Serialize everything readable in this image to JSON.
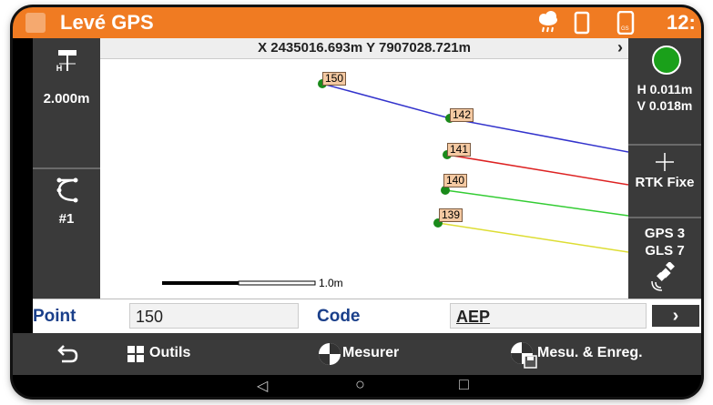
{
  "app": {
    "title": "Levé GPS",
    "clock": "12:"
  },
  "status": {
    "icons": [
      "cloud-rain-icon",
      "battery-icon",
      "gps-device-icon"
    ],
    "device_label": "GS"
  },
  "coords": {
    "text": "X 2435016.693m Y 7907028.721m",
    "chevron": "›"
  },
  "left_panel": {
    "antenna_label": "H",
    "antenna_height": "2.000m",
    "stakeout_label": "#1"
  },
  "right_panel": {
    "precision_h": "H 0.011m",
    "precision_v": "V 0.018m",
    "solution": "RTK Fixe",
    "gps_count": "GPS 3",
    "gls_count": "GLS 7",
    "status_color": "#1aa01a"
  },
  "map": {
    "points": [
      "150",
      "142",
      "141",
      "140",
      "139"
    ],
    "line_colors": {
      "l150": "#3333cc",
      "l141": "#dd2222",
      "l140": "#33cc33",
      "l139": "#dddd33"
    },
    "scale_label": "1.0m"
  },
  "fields": {
    "point_label": "Point",
    "point_value": "150",
    "code_label": "Code",
    "code_value": "AEP",
    "next_button": "›"
  },
  "toolbar": {
    "back_label": "",
    "tools_label": "Outils",
    "measure_label": "Mesurer",
    "measure_save_label": "Mesu. & Enreg."
  },
  "navbar": {
    "back": "◁",
    "home": "○",
    "recent": "□"
  }
}
